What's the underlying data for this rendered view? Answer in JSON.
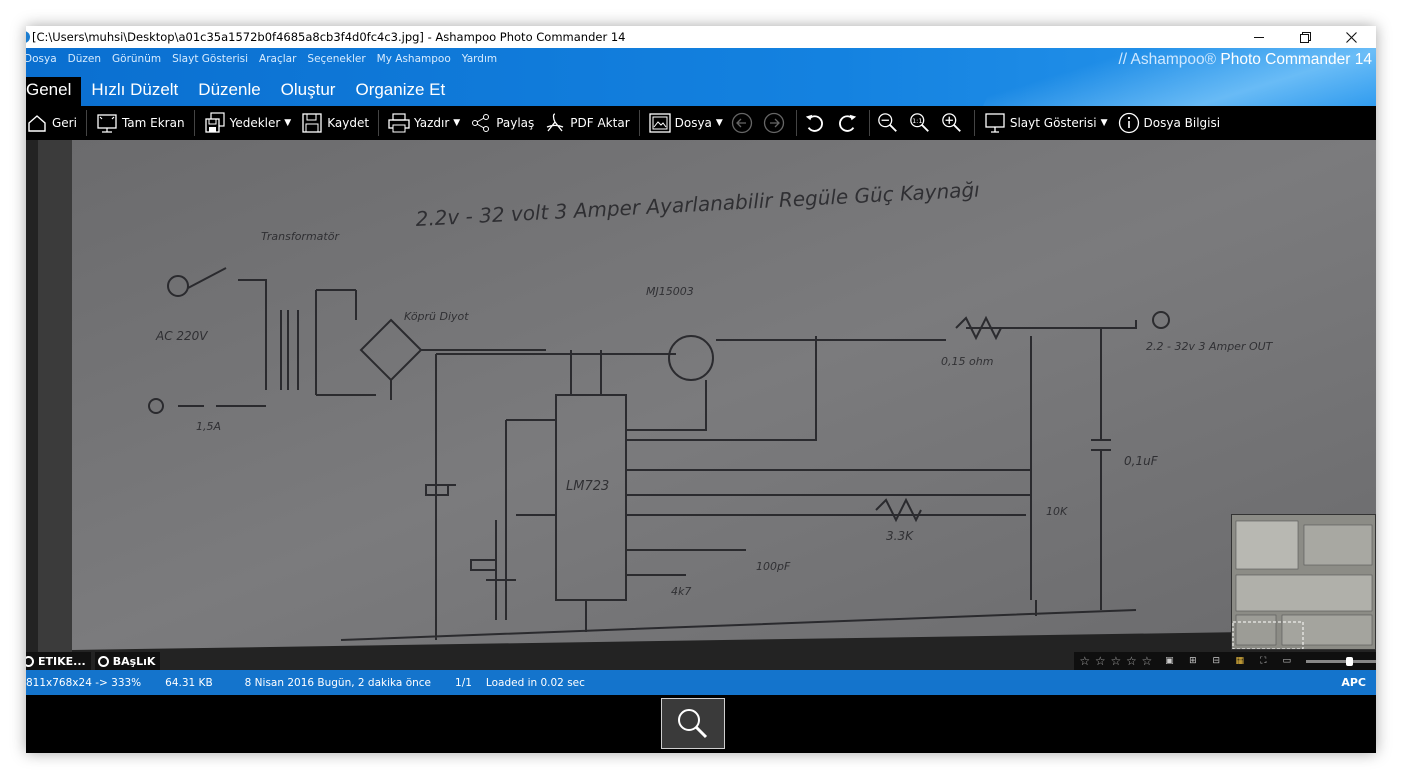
{
  "titlebar": {
    "title": "[C:\\Users\\muhsi\\Desktop\\a01c35a1572b0f4685a8cb3f4d0fc4c3.jpg] - Ashampoo Photo Commander 14",
    "minimize_icon": "minimize-icon",
    "restore_icon": "restore-icon",
    "close_icon": "close-icon"
  },
  "menu": {
    "items": [
      "Dosya",
      "Düzen",
      "Görünüm",
      "Slayt Gösterisi",
      "Araçlar",
      "Seçenekler",
      "My Ashampoo",
      "Yardım"
    ]
  },
  "brand": {
    "prefix": "// Ashampoo®",
    "product": "Photo Commander 14"
  },
  "tabs": [
    "Genel",
    "Hızlı Düzelt",
    "Düzenle",
    "Oluştur",
    "Organize Et"
  ],
  "toolbar": {
    "back": "Geri",
    "fullscreen": "Tam Ekran",
    "backups": "Yedekler",
    "save": "Kaydet",
    "print": "Yazdır",
    "share": "Paylaş",
    "pdf_export": "PDF Aktar",
    "file": "Dosya",
    "slideshow": "Slayt Gösterisi",
    "file_info": "Dosya Bilgisi"
  },
  "overlays": {
    "tag_label": "ETIKE...",
    "title_label": "BAşLıK"
  },
  "status": {
    "dimensions": "811x768x24 -> 333%",
    "filesize": "64.31 KB",
    "date": "8 Nisan 2016 Bugün, 2 dakika önce",
    "index": "1/1",
    "load_time": "Loaded in 0.02 sec",
    "mode": "APC"
  },
  "photo": {
    "handwriting": {
      "header": "2.2v - 32 volt 3 Amper  Ayarlanabilir  Regüle Güç Kaynağı",
      "transformer_label": "Transformatör",
      "ac_label": "AC 220V",
      "fuse": "1,5A",
      "bridge": "Köprü Diyot",
      "transistor": "MJ15003",
      "ic": "LM723",
      "r_sense": "0,15 ohm",
      "output": "2.2 - 32v 3 Amper OUT",
      "cap": "0,1uF",
      "r1": "3.3K",
      "pot": "10K",
      "r2": "4k7",
      "c_comp": "100pF"
    }
  }
}
